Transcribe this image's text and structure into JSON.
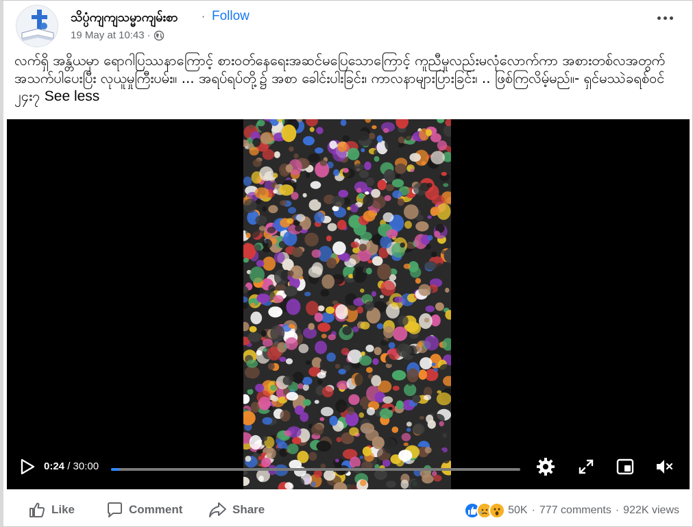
{
  "post": {
    "page_name": "သိပ္ပံကျကျသမ္မာကျမ်းစာ",
    "follow_label": "Follow",
    "timestamp": "19 May at 10:43",
    "privacy_icon": "globe-icon",
    "caption": "လက်ရှိ အန္တိယမှာ ရောဂါပြဿနာကြောင့် စားဝတ်နေရေးအဆင်မပြေသောကြောင့် ကူညီမှုလည်းမလုံလောက်ကာ အစားတစ်လအတွက် အသက်ပါပေးပြီး လုယူမှုကြီးပမ်း။ ... အရပ်ရပ်တို့၌ အစာ ခေါင်းပါးခြင်း၊ ကာလနာများပြားခြင်း၊ .. ဖြစ်ကြလိမ့်မည်။- ရှင်မဿဲခရစ်ဝင် ၂၄း၇",
    "see_less_label": "See less"
  },
  "video": {
    "current_time": "0:24",
    "duration": "30:00",
    "time_separator": " / ",
    "progress": 0.013
  },
  "footer": {
    "like_label": "Like",
    "comment_label": "Comment",
    "share_label": "Share",
    "reaction_count": "50K",
    "comments_text": "777 comments",
    "views_text": "922K views",
    "dot": "·"
  },
  "colors": {
    "accent": "#1877f2",
    "secondary_text": "#65676b",
    "progress": "#2d88ff"
  }
}
